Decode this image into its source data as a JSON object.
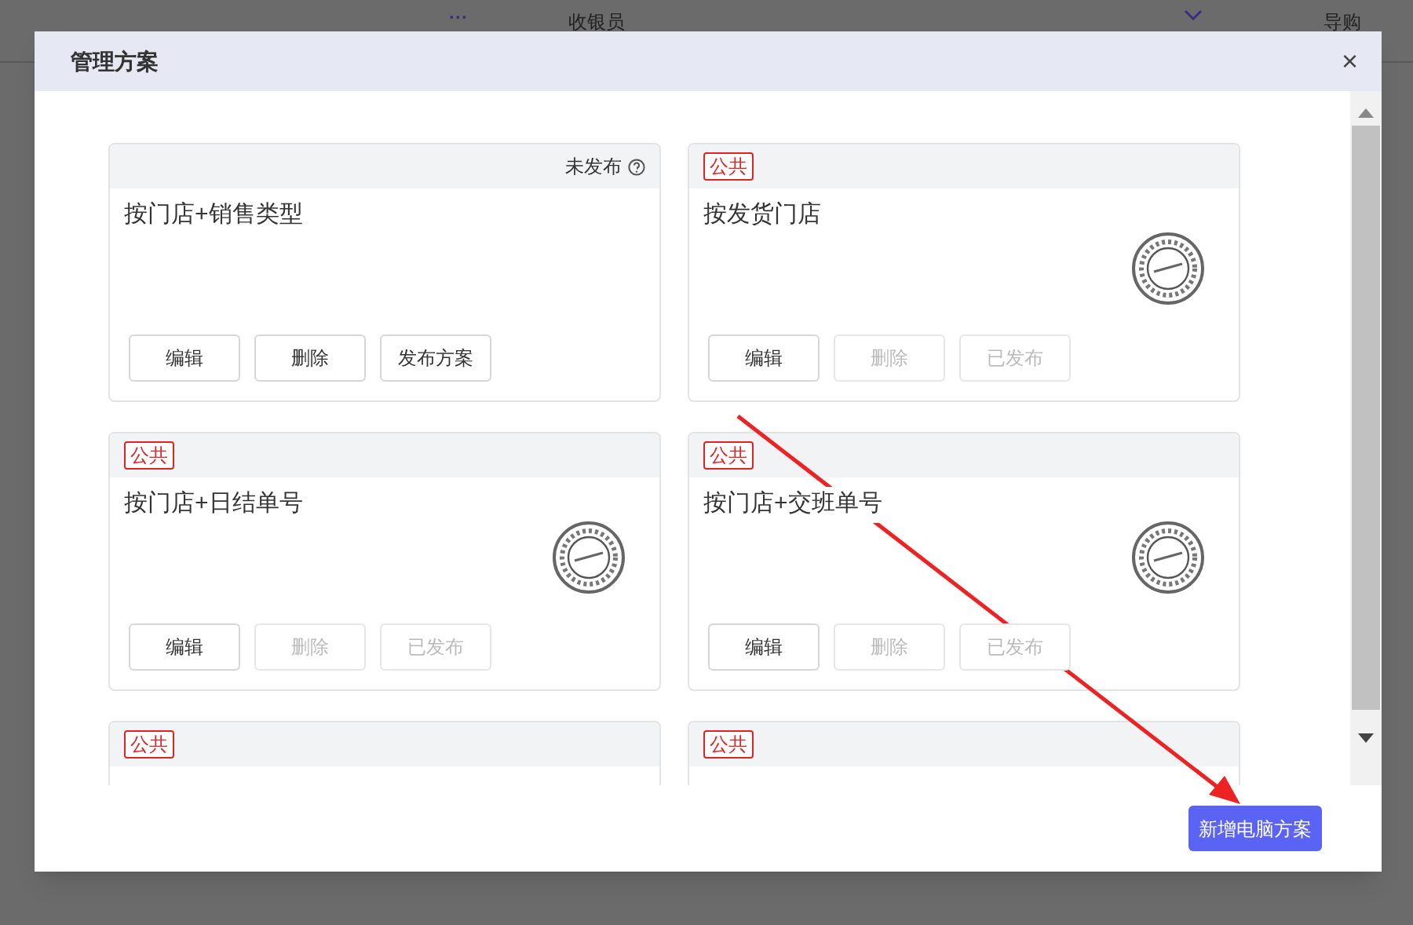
{
  "background": {
    "more": "···",
    "columns": [
      "收银员",
      "导购"
    ]
  },
  "dialog": {
    "title": "管理方案",
    "close": "×",
    "cards": [
      {
        "status": "未发布",
        "title": "按门店+销售类型",
        "published": false,
        "buttons": [
          {
            "label": "编辑",
            "disabled": false
          },
          {
            "label": "删除",
            "disabled": false
          },
          {
            "label": "发布方案",
            "disabled": false
          }
        ]
      },
      {
        "tag": "公共",
        "title": "按发货门店",
        "published": true,
        "buttons": [
          {
            "label": "编辑",
            "disabled": false
          },
          {
            "label": "删除",
            "disabled": true
          },
          {
            "label": "已发布",
            "disabled": true
          }
        ]
      },
      {
        "tag": "公共",
        "title": "按门店+日结单号",
        "published": true,
        "buttons": [
          {
            "label": "编辑",
            "disabled": false
          },
          {
            "label": "删除",
            "disabled": true
          },
          {
            "label": "已发布",
            "disabled": true
          }
        ]
      },
      {
        "tag": "公共",
        "title": "按门店+交班单号",
        "published": true,
        "buttons": [
          {
            "label": "编辑",
            "disabled": false
          },
          {
            "label": "删除",
            "disabled": true
          },
          {
            "label": "已发布",
            "disabled": true
          }
        ]
      },
      {
        "tag": "公共"
      },
      {
        "tag": "公共"
      }
    ],
    "add_button": "新增电脑方案"
  }
}
